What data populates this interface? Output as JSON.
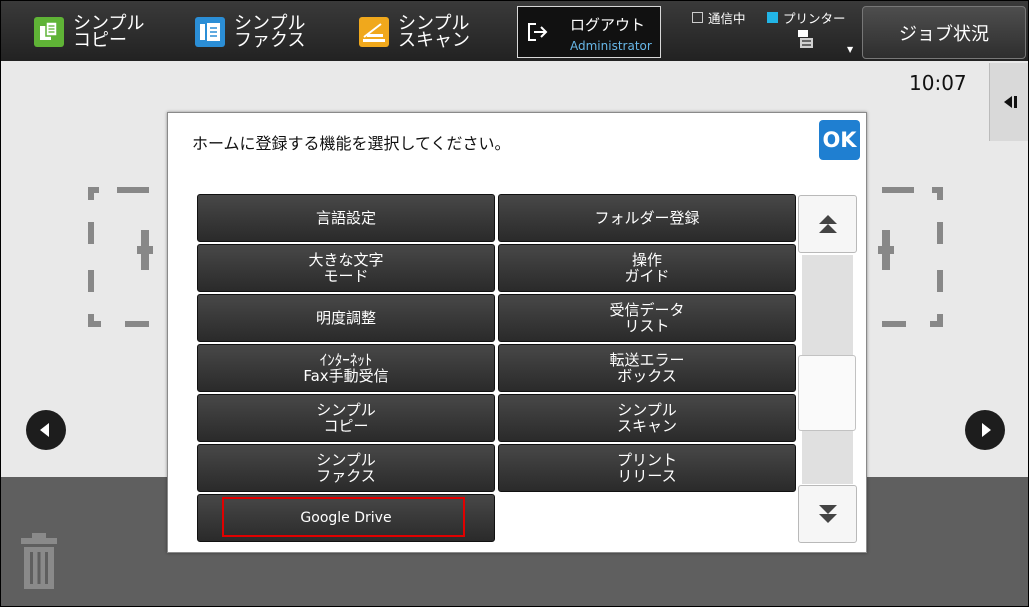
{
  "topbar": {
    "shortcuts": [
      {
        "label": "シンプル\nコピー",
        "color": "#5fb336"
      },
      {
        "label": "シンプル\nファクス",
        "color": "#2b8ed6"
      },
      {
        "label": "シンプル\nスキャン",
        "color": "#f0a81c"
      }
    ],
    "logout": {
      "title": "ログアウト",
      "user": "Administrator"
    },
    "status": {
      "communicating": "通信中",
      "printer": "プリンター"
    },
    "job_status": "ジョブ状況"
  },
  "clock": "10:07",
  "dialog": {
    "title": "ホームに登録する機能を選択してください。",
    "ok": "OK",
    "functions": [
      {
        "label": "言語設定"
      },
      {
        "label": "フォルダー登録"
      },
      {
        "label": "大きな文字\nモード"
      },
      {
        "label": "操作\nガイド"
      },
      {
        "label": "明度調整"
      },
      {
        "label": "受信データ\nリスト"
      },
      {
        "label": "ｲﾝﾀｰﾈｯﾄ\nFax手動受信"
      },
      {
        "label": "転送エラー\nボックス"
      },
      {
        "label": "シンプル\nコピー"
      },
      {
        "label": "シンプル\nスキャン"
      },
      {
        "label": "シンプル\nファクス"
      },
      {
        "label": "プリント\nリリース"
      },
      {
        "label": "Google Drive",
        "selected": true
      }
    ],
    "scroll": {
      "position": 0.66
    },
    "highlight_color": "#e00000"
  },
  "colors": {
    "accent": "#1f7fd1",
    "printer_indicator": "#22b5e6"
  }
}
